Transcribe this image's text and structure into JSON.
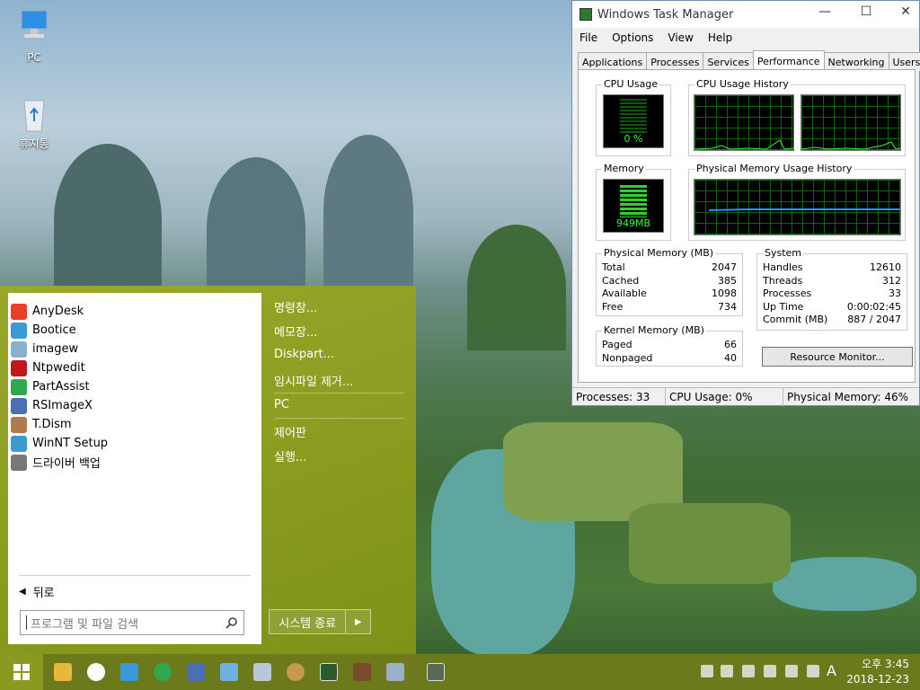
{
  "desktop": {
    "icons": [
      {
        "label": "PC",
        "icon": "monitor-icon"
      },
      {
        "label": "휴지통",
        "icon": "recycle-bin-icon"
      }
    ]
  },
  "start_menu": {
    "programs": [
      {
        "label": "AnyDesk",
        "icon": "anydesk-icon",
        "color": "#e8402a"
      },
      {
        "label": "Bootice",
        "icon": "butterfly-icon",
        "color": "#3a9ad9"
      },
      {
        "label": "imagew",
        "icon": "imagew-icon",
        "color": "#8ab0d0"
      },
      {
        "label": "Ntpwedit",
        "icon": "ntpwedit-icon",
        "color": "#c01818"
      },
      {
        "label": "PartAssist",
        "icon": "partassist-icon",
        "color": "#2fa84f"
      },
      {
        "label": "RSImageX",
        "icon": "rsimagex-icon",
        "color": "#4a6fb5"
      },
      {
        "label": "T.Dism",
        "icon": "tdism-icon",
        "color": "#b07a4a"
      },
      {
        "label": "WinNT Setup",
        "icon": "winnt-setup-icon",
        "color": "#3d9ad0"
      },
      {
        "label": "드라이버 백업",
        "icon": "driver-backup-icon",
        "color": "#777777"
      }
    ],
    "back_label": "뒤로",
    "search_placeholder": "프로그램 및 파일 검색",
    "right_links": [
      "명령창...",
      "메모장...",
      "Diskpart...",
      "임시파일 제거...",
      "PC",
      "제어판",
      "실행..."
    ],
    "shutdown_label": "시스템 종료"
  },
  "task_manager": {
    "title": "Windows Task Manager",
    "menu": [
      "File",
      "Options",
      "View",
      "Help"
    ],
    "tabs": [
      "Applications",
      "Processes",
      "Services",
      "Performance",
      "Networking",
      "Users"
    ],
    "active_tab": "Performance",
    "cpu_usage_title": "CPU Usage",
    "cpu_usage_value": "0 %",
    "cpu_history_title": "CPU Usage History",
    "memory_title": "Memory",
    "memory_value": "949MB",
    "mem_history_title": "Physical Memory Usage History",
    "physical_memory": {
      "title": "Physical Memory (MB)",
      "rows": [
        {
          "k": "Total",
          "v": "2047"
        },
        {
          "k": "Cached",
          "v": "385"
        },
        {
          "k": "Available",
          "v": "1098"
        },
        {
          "k": "Free",
          "v": "734"
        }
      ]
    },
    "kernel_memory": {
      "title": "Kernel Memory (MB)",
      "rows": [
        {
          "k": "Paged",
          "v": "66"
        },
        {
          "k": "Nonpaged",
          "v": "40"
        }
      ]
    },
    "system": {
      "title": "System",
      "rows": [
        {
          "k": "Handles",
          "v": "12610"
        },
        {
          "k": "Threads",
          "v": "312"
        },
        {
          "k": "Processes",
          "v": "33"
        },
        {
          "k": "Up Time",
          "v": "0:00:02:45"
        },
        {
          "k": "Commit (MB)",
          "v": "887 / 2047"
        }
      ]
    },
    "resource_monitor_label": "Resource Monitor...",
    "status": {
      "processes": "Processes: 33",
      "cpu": "CPU Usage: 0%",
      "memory": "Physical Memory: 46%"
    }
  },
  "taskbar": {
    "ime": "A",
    "time": "오후 3:45",
    "date": "2018-12-23"
  }
}
